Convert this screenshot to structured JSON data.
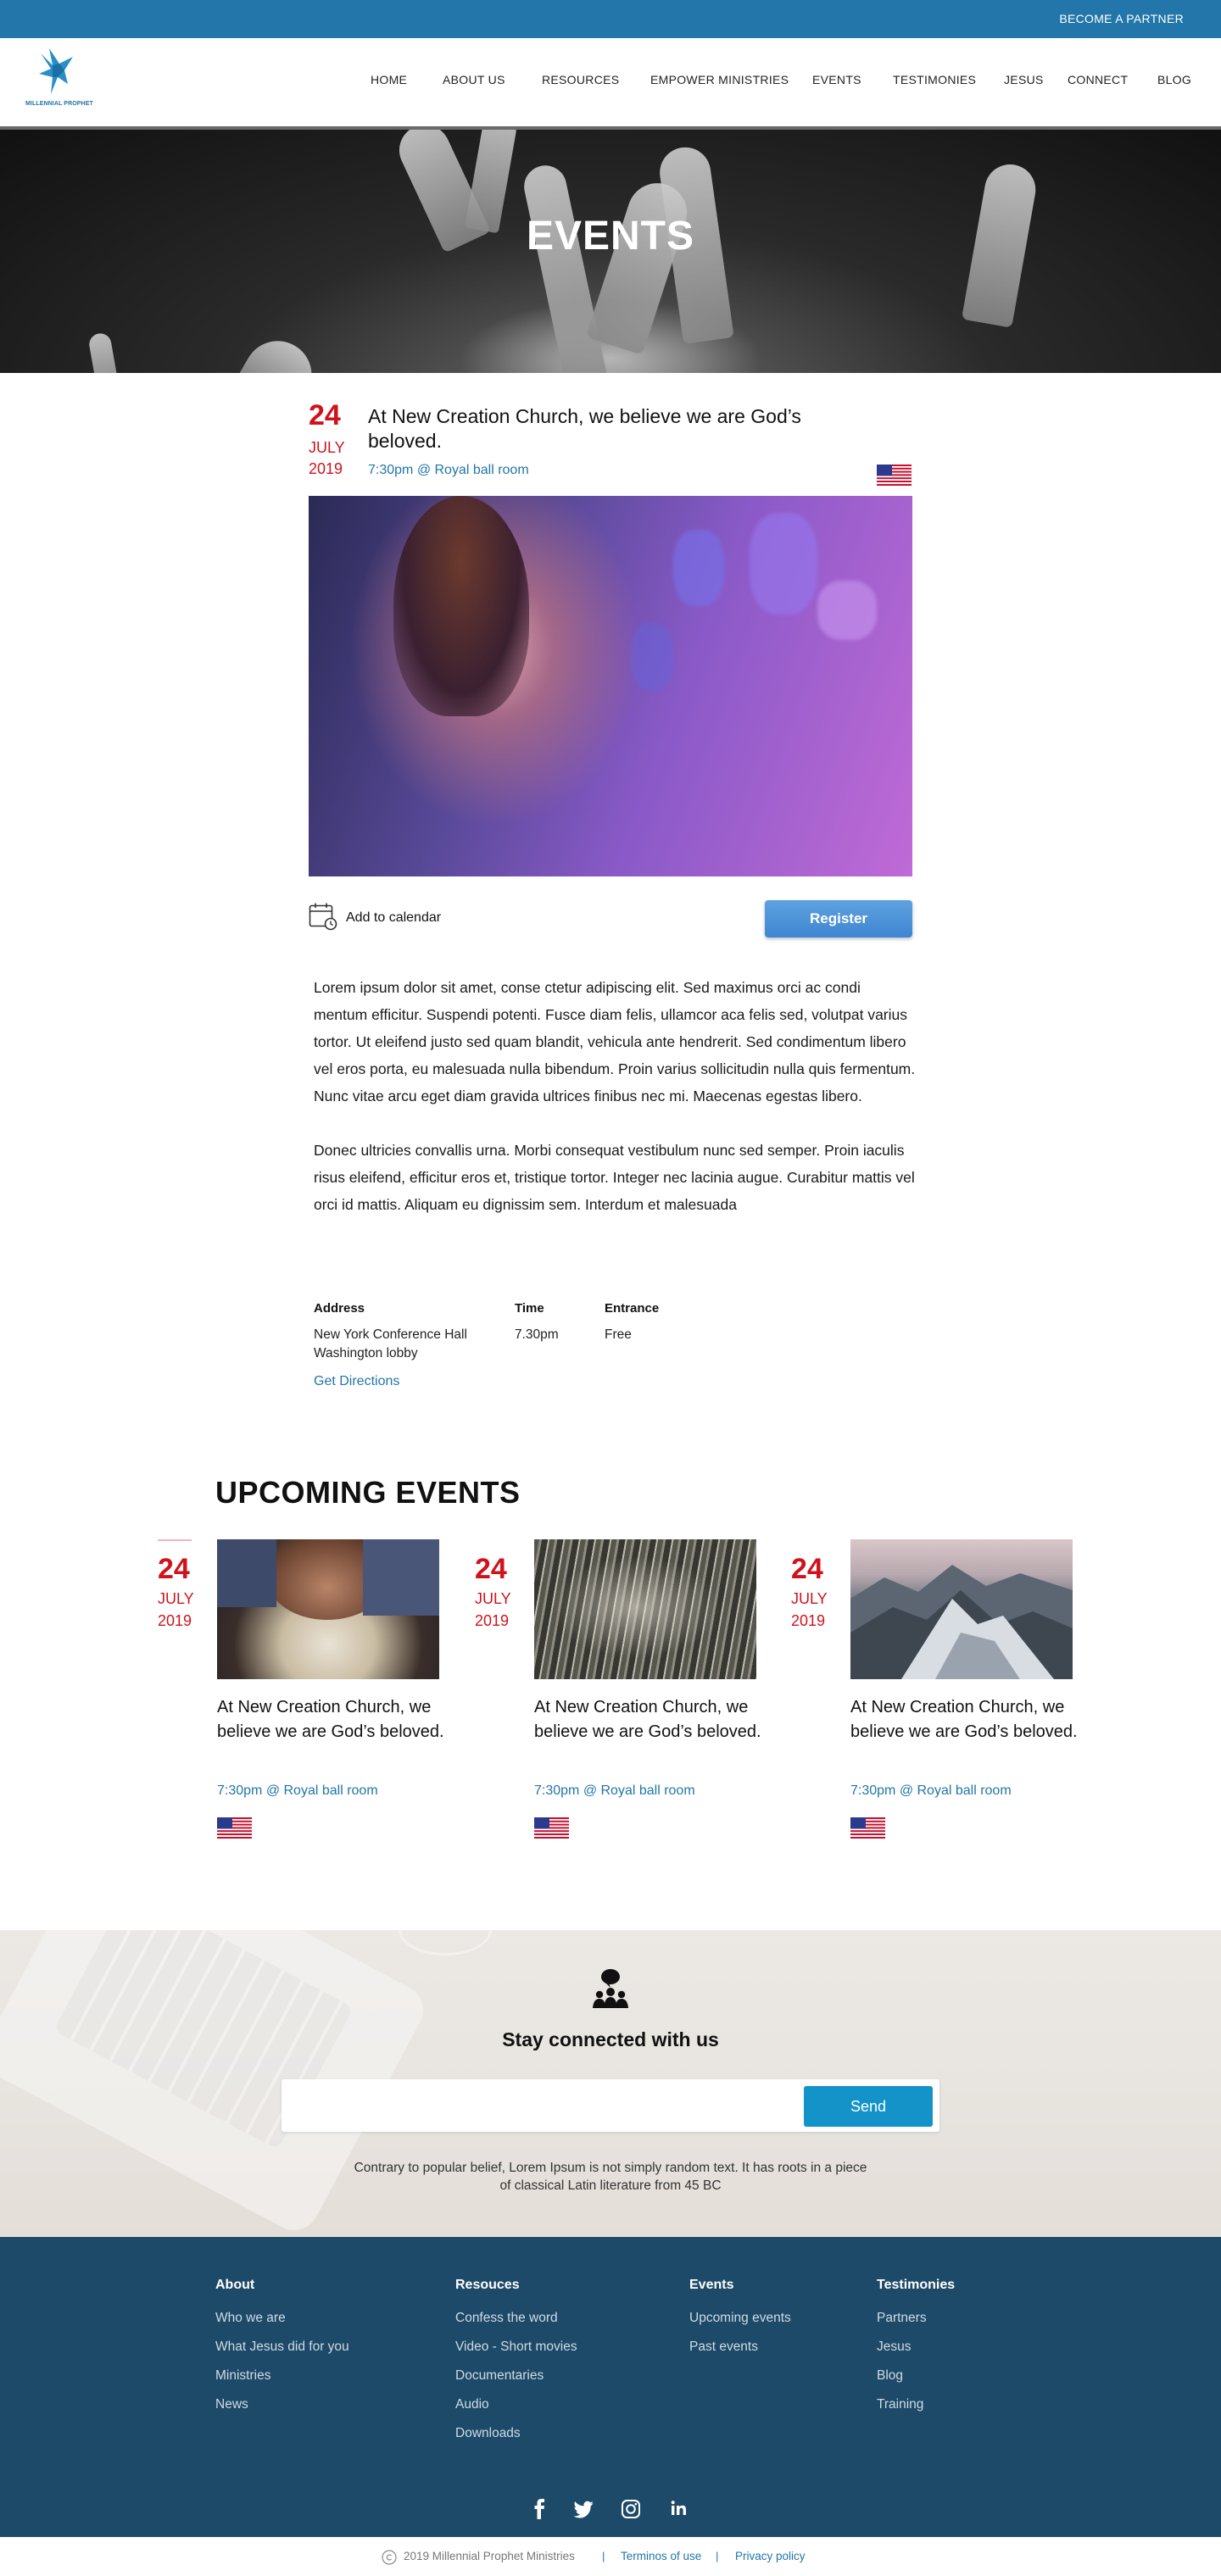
{
  "topbar": {
    "partner_label": "BECOME A PARTNER"
  },
  "brand": {
    "logo_text": "MILLENNIAL PROPHET",
    "accent": "#2276a9"
  },
  "nav": {
    "items": [
      {
        "label": "HOME"
      },
      {
        "label": "ABOUT US"
      },
      {
        "label": "RESOURCES"
      },
      {
        "label": "EMPOWER MINISTRIES"
      },
      {
        "label": "EVENTS"
      },
      {
        "label": "TESTIMONIES"
      },
      {
        "label": "JESUS"
      },
      {
        "label": "CONNECT"
      },
      {
        "label": "BLOG"
      }
    ]
  },
  "hero": {
    "title": "EVENTS"
  },
  "event": {
    "day": "24",
    "month": "JULY",
    "year": "2019",
    "title": "At New Creation Church, we believe we are God’s beloved.",
    "time_place": "7:30pm @ Royal ball room",
    "flag_icon": "us-flag-icon",
    "add_to_calendar": "Add to calendar",
    "register_label": "Register",
    "description": [
      "Lorem ipsum dolor sit amet, conse ctetur adipiscing elit. Sed maximus orci ac condi mentum efficitur. Suspendi potenti. Fusce diam felis, ullamcor aca felis sed, volutpat varius tortor. Ut eleifend justo sed quam blandit, vehicula ante hendrerit. Sed condimentum libero vel eros porta, eu malesuada nulla bibendum. Proin varius sollicitudin nulla quis fermentum. Nunc vitae arcu eget diam gravida ultrices finibus nec mi. Maecenas egestas libero.",
      "Donec ultricies convallis urna. Morbi consequat vestibulum nunc sed semper. Proin iaculis risus eleifend, efficitur eros et, tristique tortor. Integer nec lacinia augue. Curabitur mattis vel orci id mattis. Aliquam eu dignissim sem. Interdum et malesuada"
    ],
    "info": {
      "address_label": "Address",
      "address_line1": "New York Conference Hall",
      "address_line2": "Washington lobby",
      "time_label": "Time",
      "time_value": "7.30pm",
      "entrance_label": "Entrance",
      "entrance_value": "Free",
      "directions": "Get Directions"
    }
  },
  "upcoming": {
    "title": "UPCOMING EVENTS",
    "cards": [
      {
        "day": "24",
        "month": "JULY",
        "year": "2019",
        "title": "At New Creation Church, we believe we are God’s beloved.",
        "time_place": "7:30pm @ Royal ball room"
      },
      {
        "day": "24",
        "month": "JULY",
        "year": "2019",
        "title": "At New Creation Church, we believe we are God’s beloved.",
        "time_place": "7:30pm @ Royal ball room"
      },
      {
        "day": "24",
        "month": "JULY",
        "year": "2019",
        "title": "At New Creation Church, we believe we are God’s beloved.",
        "time_place": "7:30pm @ Royal ball room"
      }
    ]
  },
  "newsletter": {
    "title": "Stay connected with us",
    "email_placeholder": "",
    "send_label": "Send",
    "note_line1": "Contrary to popular belief, Lorem Ipsum is not simply random text. It has roots in a piece",
    "note_line2": "of classical Latin literature from 45 BC"
  },
  "footer": {
    "columns": [
      {
        "heading": "About",
        "links": [
          "Who we are",
          "What Jesus did for you",
          "Ministries",
          "News"
        ]
      },
      {
        "heading": "Resouces",
        "links": [
          "Confess the word",
          "Video - Short movies",
          "Documentaries",
          "Audio",
          "Downloads"
        ]
      },
      {
        "heading": "Events",
        "links": [
          "Upcoming events",
          "Past events"
        ]
      },
      {
        "heading": "Testimonies",
        "links": [
          "Partners",
          "Jesus",
          "Blog",
          "Training"
        ]
      }
    ],
    "social": [
      "facebook-icon",
      "twitter-icon",
      "instagram-icon",
      "linkedin-icon"
    ],
    "copyright": "2019 Millennial Prophet Ministries",
    "terms": "Terminos of use",
    "privacy": "Privacy policy",
    "background": "#1d4a68"
  }
}
